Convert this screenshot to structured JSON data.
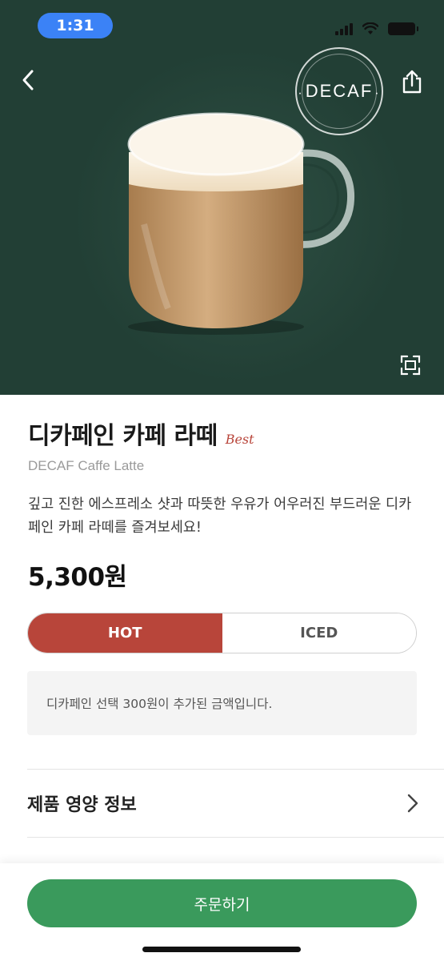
{
  "status_bar": {
    "time": "1:31"
  },
  "hero": {
    "badge_text": "DECAF",
    "bg_color": "#223f35"
  },
  "product": {
    "name": "디카페인 카페 라떼",
    "tag": "Best",
    "english_name": "DECAF Caffe Latte",
    "description": "깊고 진한 에스프레소 샷과 따뜻한 우유가 어우러진 부드러운 디카페인 카페 라떼를 즐겨보세요!",
    "price": "5,300원"
  },
  "temperature_options": [
    {
      "label": "HOT",
      "selected": true
    },
    {
      "label": "ICED",
      "selected": false
    }
  ],
  "notice": "디카페인 선택 300원이 추가된 금액입니다.",
  "nutrition": {
    "label": "제품 영양 정보"
  },
  "order_button": {
    "label": "주문하기",
    "color": "#3a9a5c"
  },
  "accent_color": "#b8453a",
  "icons": [
    "back-icon",
    "share-icon",
    "expand-icon",
    "chevron-right-icon",
    "signal-icon",
    "wifi-icon",
    "battery-icon"
  ]
}
